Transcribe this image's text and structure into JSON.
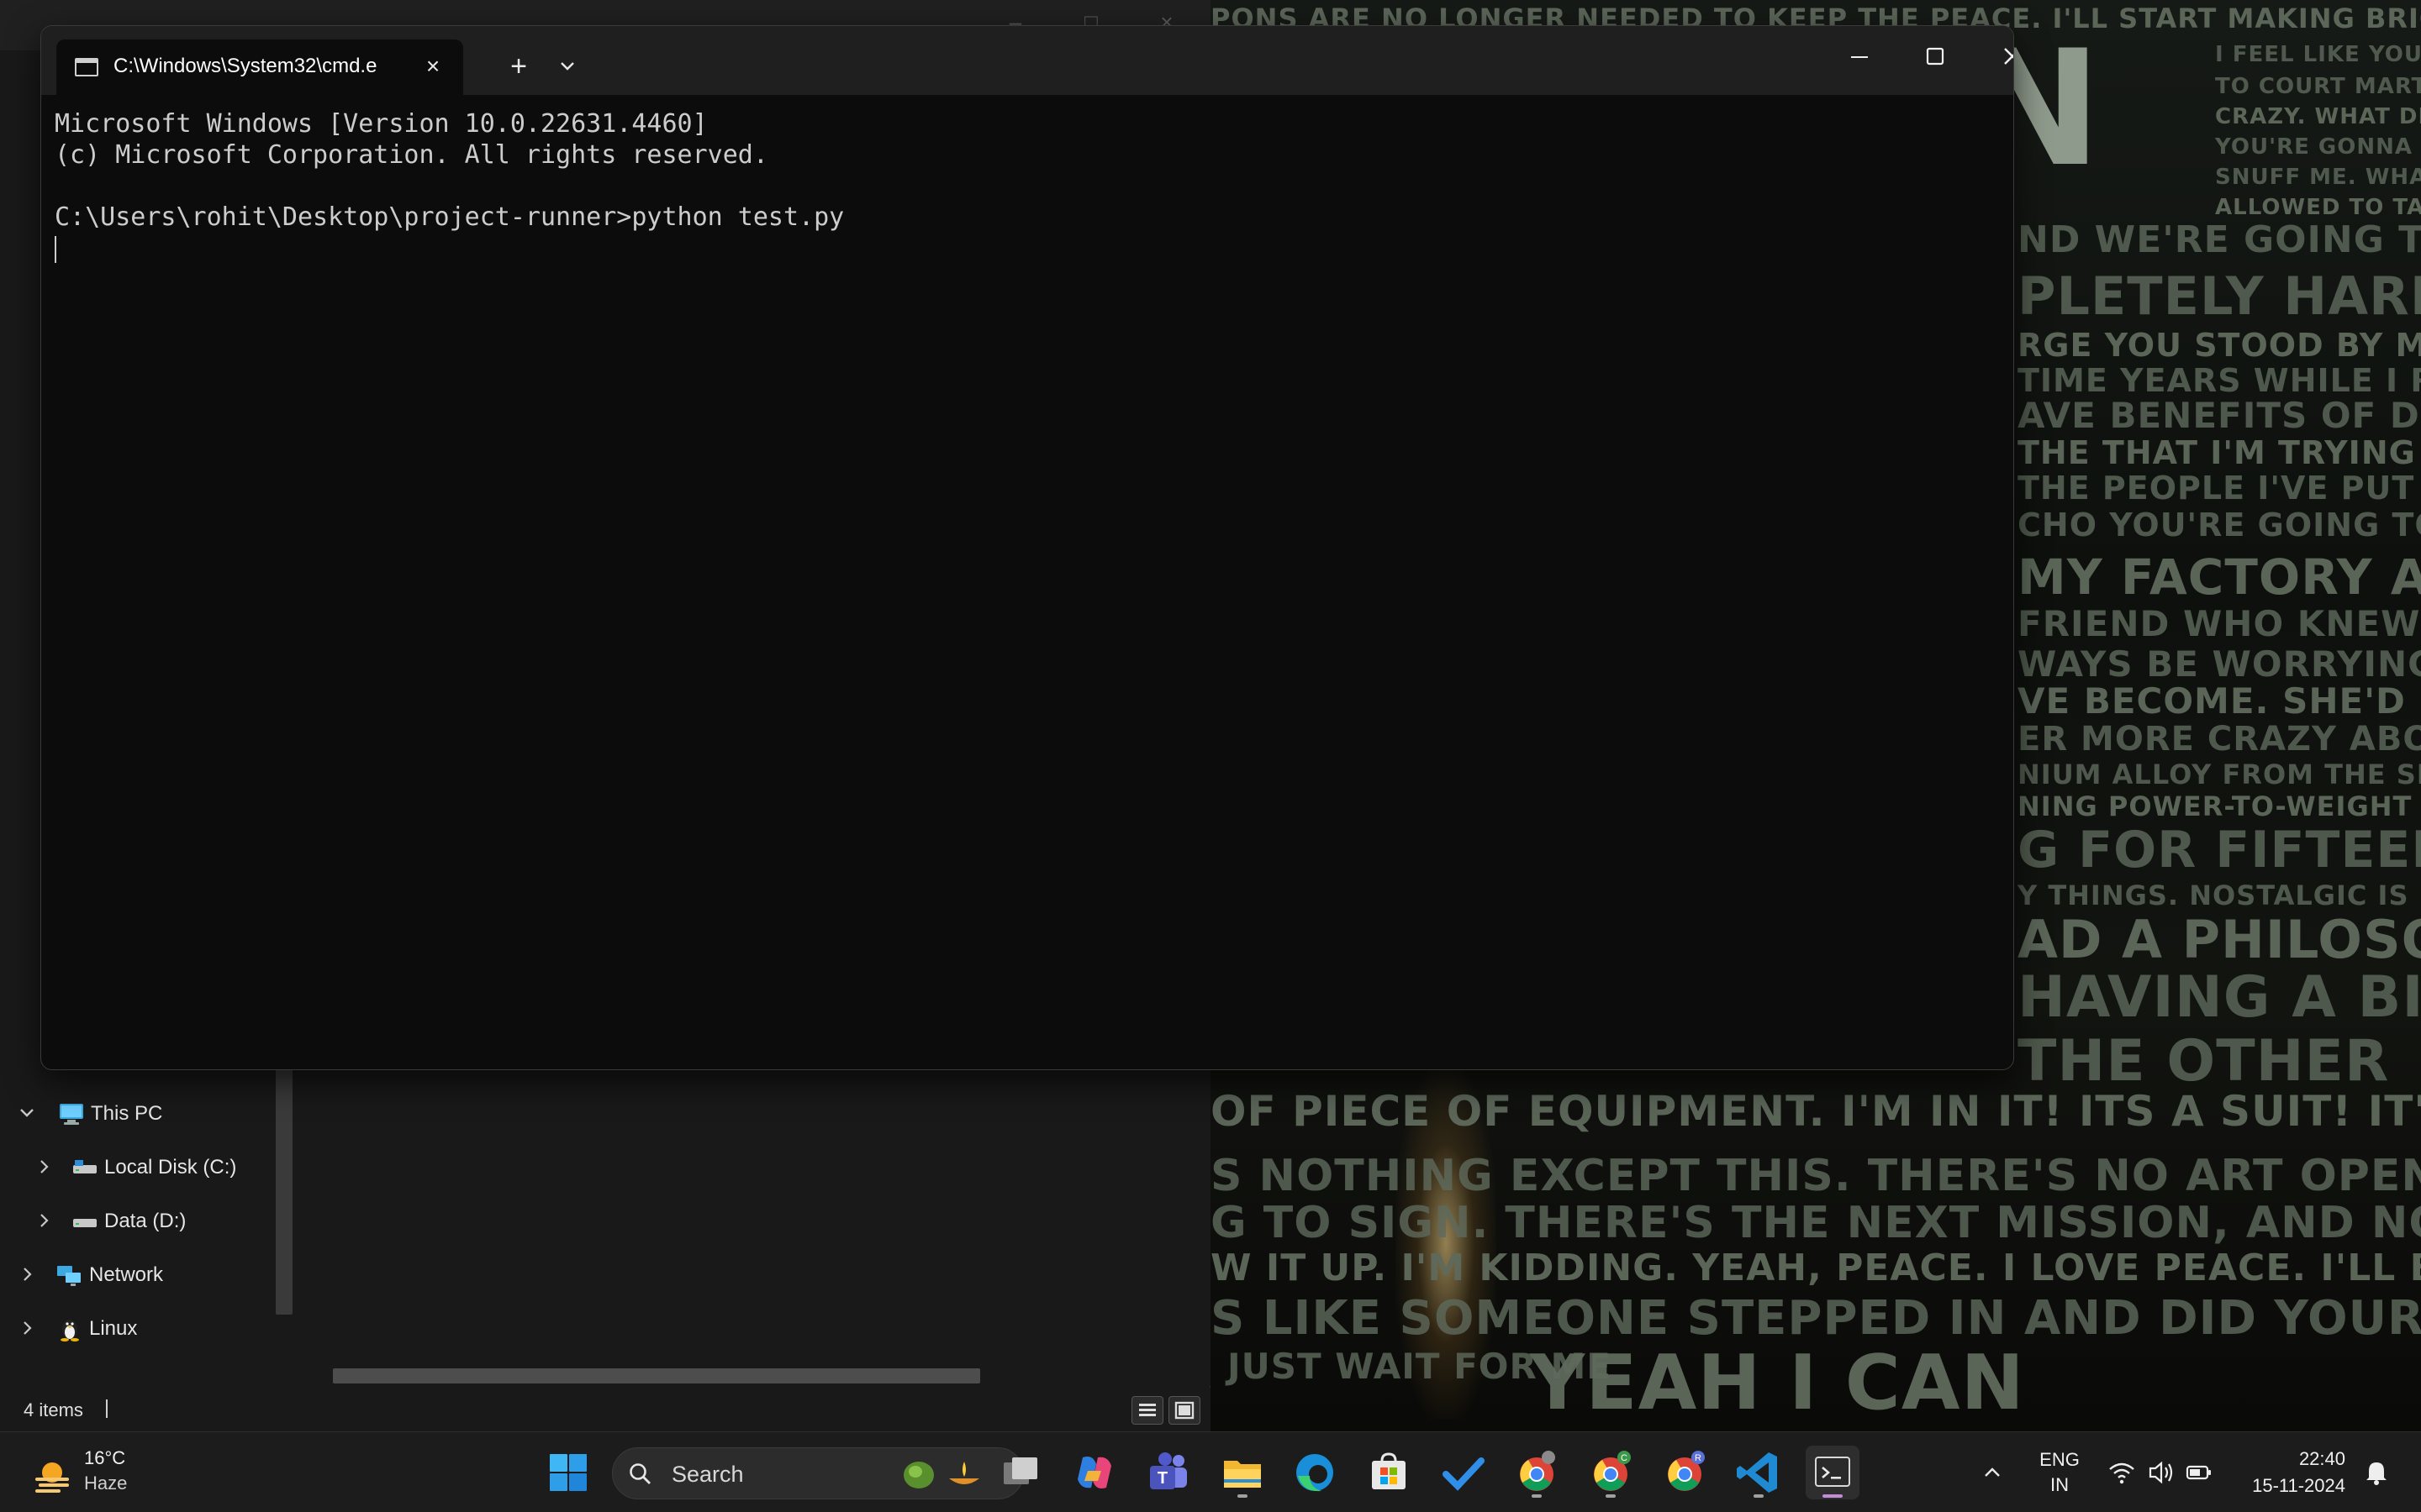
{
  "terminal": {
    "tab_title": "C:\\Windows\\System32\\cmd.e",
    "lines": [
      "Microsoft Windows [Version 10.0.22631.4460]",
      "(c) Microsoft Corporation. All rights reserved.",
      "",
      "C:\\Users\\rohit\\Desktop\\project-runner>python test.py"
    ]
  },
  "explorer": {
    "nav_items": [
      {
        "label": "This PC",
        "icon": "computer-icon"
      },
      {
        "label": "Local Disk (C:)",
        "icon": "drive-icon"
      },
      {
        "label": "Data (D:)",
        "icon": "drive-icon"
      },
      {
        "label": "Network",
        "icon": "network-icon"
      },
      {
        "label": "Linux",
        "icon": "linux-penguin-icon"
      }
    ],
    "status_items": "4 items"
  },
  "wallpaper": {
    "lines": [
      "PONS ARE NO LONGER NEEDED TO KEEP THE PEACE. I'LL START MAKING BRICKS AND BEAMS FOR BABY",
      "I FEEL LIKE YOU'RE",
      "TO COURT MARTIA",
      "CRAZY. WHAT DID I DO",
      "YOU'RE GONNA PUL",
      "SNUFF ME. WHAT,",
      "ALLOWED TO TALK?",
      "ND WE'RE GOING TO STIC",
      "PLETELY HARM",
      "RGE YOU STOOD BY MY SIDE A",
      "TIME YEARS WHILE I REA",
      "AVE BENEFITS OF DESTRUCT",
      "THE THAT I'M TRYING TO PRO",
      "THE PEOPLE I'VE PUT IN HAR",
      "CHO YOU'RE GOING TO WA",
      "MY FACTORY AT H",
      "FRIEND WHO KNEW M",
      "WAYS BE WORRYING",
      "VE BECOME. SHE'D BE W",
      "ER MORE CRAZY ABOU",
      "NIUM ALLOY FROM THE SERAPHIM",
      "NING POWER-TO-WEIGHT RATIO",
      "G FOR FIFTEEN MIN",
      "Y THINGS. NOSTALGIC IS NOT ONE",
      "AD A PHILOSO",
      "HAVING A BIG",
      "THE OTHER",
      "OF PIECE OF EQUIPMENT. I'M IN IT! ITS A SUIT! IT'S",
      "S NOTHING EXCEPT THIS. THERE'S NO ART OPENING, NO CHA",
      "G TO SIGN. THERE'S THE NEXT MISSION, AND NOTHING",
      "W IT UP. I'M KIDDING. YEAH, PEACE. I LOVE PEACE. I'LL BE OUT OF A JOB",
      "S LIKE SOMEONE STEPPED IN AND DID YOUR JOB FOR",
      "JUST WAIT FOR ME",
      "YEAH I CAN"
    ],
    "big_word": "AN"
  },
  "taskbar": {
    "weather_temp": "16°C",
    "weather_condition": "Haze",
    "search_label": "Search",
    "language_line1": "ENG",
    "language_line2": "IN",
    "time": "22:40",
    "date": "15-11-2024",
    "apps": [
      "start-windows-icon",
      "task-view-icon",
      "copilot-icon",
      "teams-icon",
      "file-explorer-icon",
      "edge-icon",
      "microsoft-store-icon",
      "todo-icon",
      "chrome-icon",
      "chrome-profile-c-icon",
      "chrome-profile-r-icon",
      "vscode-icon",
      "terminal-icon"
    ]
  }
}
